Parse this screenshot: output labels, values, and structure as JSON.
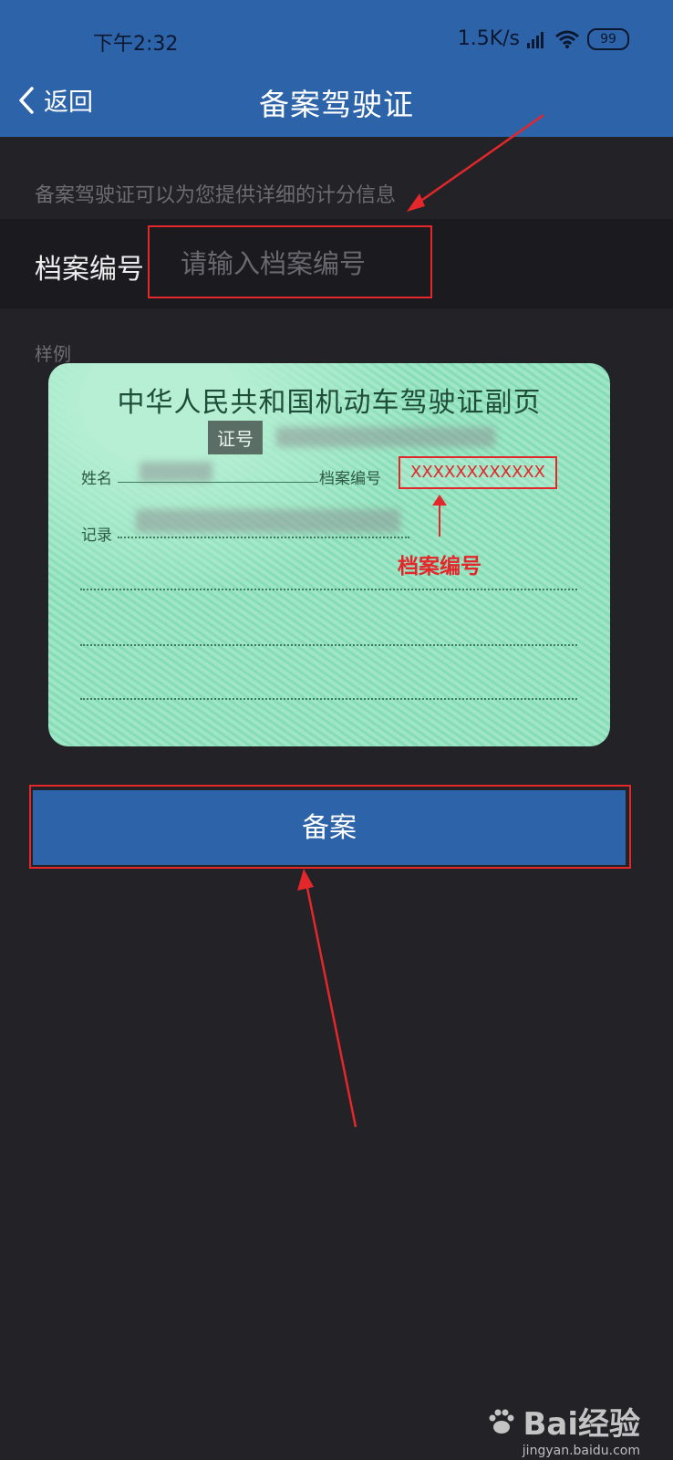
{
  "status_bar": {
    "time": "下午2:32",
    "network_speed": "1.5K/s",
    "battery": "99",
    "icons": [
      "hd-signal-icon",
      "wifi-icon",
      "battery-icon"
    ]
  },
  "header": {
    "back_label": "返回",
    "title": "备案驾驶证"
  },
  "description": "备案驾驶证可以为您提供详细的计分信息",
  "form": {
    "field_label": "档案编号",
    "field_placeholder": "请输入档案编号",
    "field_value": ""
  },
  "sample": {
    "label": "样例",
    "card_title": "中华人民共和国机动车驾驶证副页",
    "card_id_label": "证号",
    "card_name_label": "姓名",
    "card_file_no_label": "档案编号",
    "card_file_no_value": "XXXXXXXXXXXX",
    "card_record_label": "记录",
    "annotation": "档案编号"
  },
  "submit_label": "备案",
  "watermark": {
    "main": "Bai经验",
    "sub": "jingyan.baidu.com"
  },
  "colors": {
    "header_bg": "#2d63a8",
    "page_bg": "#232227",
    "highlight_red": "#e3272b"
  }
}
